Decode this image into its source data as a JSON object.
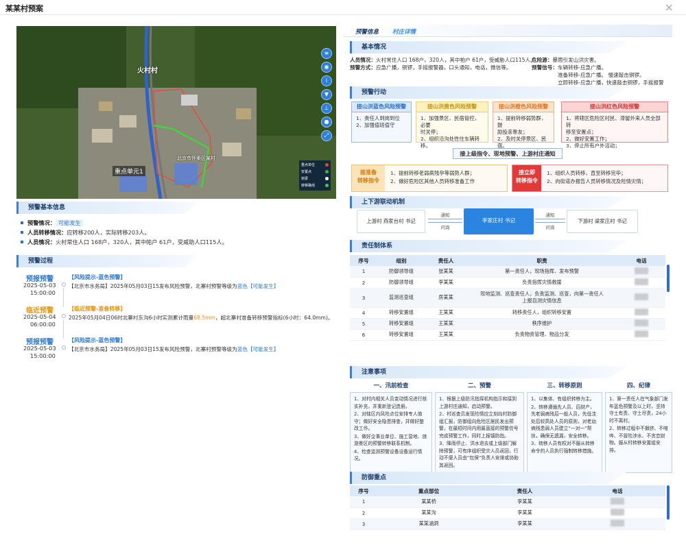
{
  "window": {
    "title": "某某村预案",
    "close": "×"
  },
  "map": {
    "labels": {
      "village": "火村村",
      "unit": "重点单元1",
      "area": "北京市怀柔区某村"
    },
    "legend": [
      {
        "label": "重点单位",
        "color": "#e8473d"
      },
      {
        "label": "安置点",
        "color": "#39b54a"
      },
      {
        "label": "桥梁",
        "color": "#ffffff"
      },
      {
        "label": "转移路线",
        "color": "#46c846"
      }
    ],
    "controls": [
      "layers-icon",
      "eye-icon",
      "info-icon",
      "filter-icon",
      "ruler-icon",
      "pin-icon",
      "expand-icon"
    ]
  },
  "basic": {
    "title": "预警基本信息",
    "rows": [
      {
        "k": "预警情况：",
        "v": "可能发生",
        "vcolor": "#3a7fd6"
      },
      {
        "k": "人员转移情况：",
        "v": "应转移200人，实际转移203人。"
      },
      {
        "k": "人员情况：",
        "v": "火村常住人口 168户，320人，其中帕户 61户，受威助人口115人。"
      }
    ]
  },
  "process": {
    "title": "预警过程",
    "items": [
      {
        "label": "预报预警",
        "color": "#2c78d2",
        "date": "2025-05-03",
        "time": "15:00:00",
        "event": "【风险提示-蓝色预警】",
        "ecolor": "#2c78d2",
        "desc_a": "【北京市水务局】2025年05月03日15发布风险预警，北寨村预警等级为",
        "desc_hl": "蓝色",
        "desc_b": "【可能发生】",
        "hlcolor": "#2c78d2"
      },
      {
        "label": "临近预警",
        "color": "#e8920c",
        "date": "2025-05-04",
        "time": "06:00:00",
        "event": "【临近预警-准备转移】",
        "ecolor": "#e8920c",
        "desc_a": "2025年05月04日06时北寨村东沟6小时实测累计雨量",
        "desc_hl": "68.5mm",
        "desc_b": "，超北寨村准备转移预警指标(6小时：64.0mm)。",
        "hlcolor": "#e8920c"
      },
      {
        "label": "预报预警",
        "color": "#2c78d2",
        "date": "2025-05-03",
        "time": "15:00:00",
        "event": "【风险提示-蓝色预警】",
        "ecolor": "#2c78d2",
        "desc_a": "【北京市水务局】2025年05月03日15发布风险预警，北寨村预警等级为",
        "desc_hl": "蓝色",
        "desc_b": "【可能发生】",
        "hlcolor": "#2c78d2"
      }
    ]
  },
  "tabs": [
    "预警信息",
    "村庄详情"
  ],
  "situation": {
    "title": "基本情况",
    "lines": [
      {
        "k": "人员情况：",
        "v": "火村常住人口 168户，320人，其中帕户 61户，受威胁人口115人。"
      },
      {
        "k": "预警方式：",
        "v": "应急广播，铜锣，手摇报警器，口头通知，电话，微信等。"
      }
    ],
    "danger_k": "危险源：",
    "danger_v": "暴雨引发山洪灾害。",
    "signal_k": "预警信号：",
    "signal_v": [
      "车辆转移-应急广播。",
      "准备转移-应急广播。 慢速敲击铜锣。",
      "立即转移-应急广播，快速敲击铜锣，手摇报警器。"
    ]
  },
  "action": {
    "title": "预警行动",
    "cards": [
      {
        "h": "接山洪蓝色风险预警",
        "lines": [
          "1、责任人到岗到位",
          "2、加强值班值守"
        ]
      },
      {
        "h": "接山洪黄色风险预警",
        "lines": [
          "1、加强景区、民宿管控，必要",
          "   时关停；",
          "2、组织沿沟处性住车辆转移。"
        ]
      },
      {
        "h": "接山洪橙色风险预警",
        "lines": [
          "1、提前转移弱势群，鼓",
          "   励投亲靠友；",
          "2、及时关停景区、民宿。"
        ]
      },
      {
        "h": "接山洪红色风险预警",
        "lines": [
          "1、将辖区危险区村民、滞留外来人员全部转",
          "   移至安置点；",
          "2、做好安置工作；",
          "3、停止所有户外活动；"
        ]
      }
    ],
    "banner": "接上级指令、现地预警、上游村庄通知",
    "prep_h": "接准备\n转移指令",
    "prep": [
      "1、提前转移老弱病残孕等弱势人群；",
      "2、做好危险区其他人员转移准备工作"
    ],
    "imm_h": "接立即\n转移指令",
    "imm": [
      "1、组织人员转移，直至转移完毕；",
      "2、向街道办报告人员转移情况及险情灾情；"
    ]
  },
  "linkage": {
    "title": "上下游联动机制",
    "up": "上游村 燕家台村 书记",
    "mid": "李家庄村 书记",
    "down": "下游村 梁家庄村 书记",
    "notify": "通知",
    "ask": "问询"
  },
  "responsibility": {
    "title": "责任制体系",
    "headers": [
      "序号",
      "组别",
      "责任人",
      "职责",
      "电话"
    ],
    "rows": [
      [
        "1",
        "防御领导组",
        "张某某",
        "第一责任人，现场指挥、发布预警",
        ""
      ],
      [
        "2",
        "防御领导组",
        "李某某",
        "负责指挥灾情救援",
        ""
      ],
      [
        "3",
        "监测巡查组",
        "房某某",
        "现地监测、巡查责任人，负责监测、巡查，向第一责任人上报自测灾情信息",
        ""
      ],
      [
        "4",
        "转移安置组",
        "王某某",
        "转移责任人，组织转移安置",
        ""
      ],
      [
        "5",
        "转移安置组",
        "王某某",
        "秩序维护",
        ""
      ],
      [
        "6",
        "转移安置组",
        "王某某",
        "负责物资管理、物品分发",
        ""
      ]
    ]
  },
  "notes": {
    "title": "注意事项",
    "cols": [
      {
        "h": "一、汛前检查",
        "lines": [
          "1、对村内相关人员变动情况进行核实补充，并重新登记造册。",
          "2、对辖区内风险点位安排专人值守；做好安全隐患排查，并做好整改工作。",
          "3、做好企事业单位、施工营地、旅游景区的预警转移联系机制。",
          "4、检查监测预警设备设备运行情况。"
        ]
      },
      {
        "h": "二、预警",
        "lines": [
          "1、根据上级防汛指挥机构指示和接到上游村庄通知，启动预警。",
          "2、村巡查员发现险情应立刻向村防御组汇报，防御组向危险区居民发出预警，在最短时间内用最直接的预警信号完成预警工作，同时上报镇防指。",
          "3、降雨停止、洪水退去或上级部门解除预警，可有序组织受灾人员返回，行动不便人员由“包保”负责人安排或协助其返回。"
        ]
      },
      {
        "h": "三、转移原则",
        "lines": [
          "1、以集体、有组织转移为主。",
          "2、转移遵循先人员、后财产，先老弱病残后一般人员，先低洼处后较高处人员的原则，对老幼病残患弱人员建立“一对一”帮扶，确保无遗漏，安全转移。",
          "3、转移人员有权对不服从转移命令的人员执行强制转移措施。"
        ]
      },
      {
        "h": "四、纪律",
        "lines": [
          "1、第一责任人在气象部门发布蓝色预警及以上时，坚持守土有责、守土尽责，24小时不离村。",
          "2、转移过程中不摒挤、不喧哗、不冒险涉水、不贪恋财物。服从村转移安置组安排。"
        ]
      }
    ]
  },
  "defense": {
    "title": "防御重点",
    "headers": [
      "序号",
      "重点部位",
      "责任人",
      "电话"
    ],
    "rows": [
      [
        "1",
        "某某桥",
        "李某某",
        ""
      ],
      [
        "2",
        "某某沟",
        "李某某",
        ""
      ],
      [
        "3",
        "某某涵洞",
        "李某某",
        ""
      ]
    ]
  }
}
